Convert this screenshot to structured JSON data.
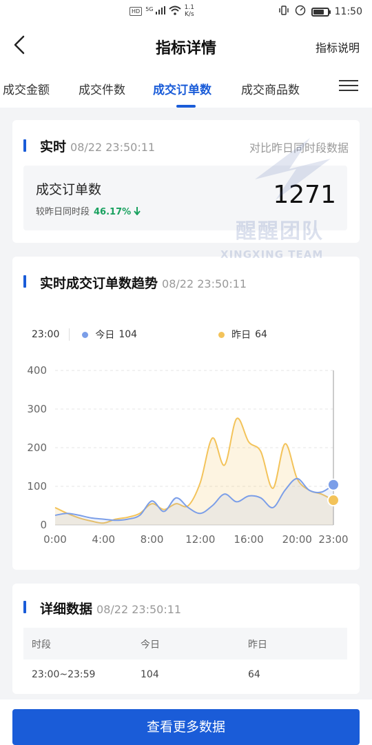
{
  "status_bar": {
    "hd": "HD",
    "signal": "5G",
    "net_speed": "1.1",
    "net_unit": "K/s",
    "time": "11:50",
    "battery_level": 0.75
  },
  "header": {
    "title": "指标详情",
    "right_link": "指标说明"
  },
  "tabs": [
    {
      "label": "成交金额",
      "active": false
    },
    {
      "label": "成交件数",
      "active": false
    },
    {
      "label": "成交订单数",
      "active": true
    },
    {
      "label": "成交商品数",
      "active": false
    }
  ],
  "realtime": {
    "title": "实时",
    "time": "08/22 23:50:11",
    "compare_link": "对比昨日同时段数据",
    "metric_name": "成交订单数",
    "compare_label": "较昨日同时段",
    "compare_pct": "46.17%",
    "value": "1271"
  },
  "watermark": {
    "text": "醒醒团队",
    "subtext": "XINGXING TEAM"
  },
  "trend": {
    "title": "实时成交订单数趋势",
    "time": "08/22 23:50:11",
    "legend_time": "23:00",
    "today_label": "今日",
    "today_value": "104",
    "yesterday_label": "昨日",
    "yesterday_value": "64"
  },
  "chart_data": {
    "type": "line",
    "x_labels": [
      "0:00",
      "4:00",
      "8:00",
      "12:00",
      "16:00",
      "20:00",
      "23:00"
    ],
    "y_ticks": [
      "0",
      "100",
      "200",
      "300",
      "400"
    ],
    "ylim": [
      0,
      400
    ],
    "xlim": [
      0,
      23
    ],
    "grid": true,
    "series": [
      {
        "name": "今日",
        "color": "#7b9ee8",
        "x": [
          0,
          1,
          2,
          3,
          4,
          5,
          6,
          7,
          8,
          9,
          10,
          11,
          12,
          13,
          14,
          15,
          16,
          17,
          18,
          19,
          20,
          21,
          22,
          23
        ],
        "y": [
          25,
          30,
          25,
          18,
          15,
          12,
          15,
          25,
          62,
          35,
          70,
          45,
          30,
          50,
          80,
          60,
          75,
          70,
          45,
          90,
          120,
          90,
          85,
          104
        ]
      },
      {
        "name": "昨日",
        "color": "#f3c35a",
        "x": [
          0,
          1,
          2,
          3,
          4,
          5,
          6,
          7,
          8,
          9,
          10,
          11,
          12,
          13,
          14,
          15,
          16,
          17,
          18,
          19,
          20,
          21,
          22,
          23
        ],
        "y": [
          45,
          30,
          18,
          10,
          5,
          15,
          20,
          30,
          55,
          40,
          55,
          50,
          110,
          225,
          155,
          275,
          215,
          190,
          95,
          210,
          120,
          90,
          80,
          64
        ]
      }
    ]
  },
  "detail": {
    "title": "详细数据",
    "time": "08/22 23:50:11",
    "headers": [
      "时段",
      "今日",
      "昨日"
    ],
    "rows": [
      [
        "23:00~23:59",
        "104",
        "64"
      ]
    ]
  },
  "bottom": {
    "button": "查看更多数据"
  },
  "colors": {
    "accent": "#1a5cd8",
    "down": "#19a15f"
  }
}
